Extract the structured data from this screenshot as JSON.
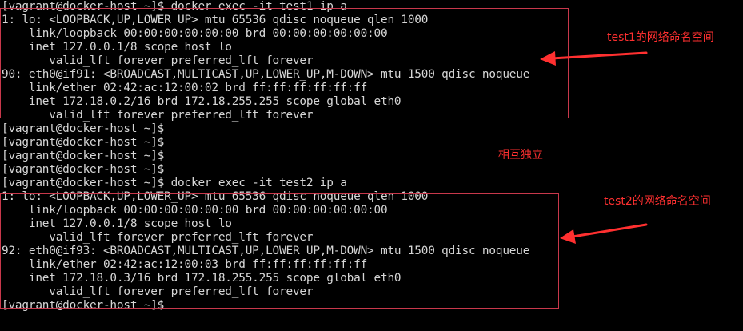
{
  "terminal": {
    "lines": [
      "[vagrant@docker-host ~]$ docker exec -it test1 ip a",
      "1: lo: <LOOPBACK,UP,LOWER_UP> mtu 65536 qdisc noqueue qlen 1000",
      "    link/loopback 00:00:00:00:00:00 brd 00:00:00:00:00:00",
      "    inet 127.0.0.1/8 scope host lo",
      "       valid_lft forever preferred_lft forever",
      "90: eth0@if91: <BROADCAST,MULTICAST,UP,LOWER_UP,M-DOWN> mtu 1500 qdisc noqueue",
      "    link/ether 02:42:ac:12:00:02 brd ff:ff:ff:ff:ff:ff",
      "    inet 172.18.0.2/16 brd 172.18.255.255 scope global eth0",
      "       valid_lft forever preferred_lft forever",
      "[vagrant@docker-host ~]$",
      "[vagrant@docker-host ~]$",
      "[vagrant@docker-host ~]$",
      "[vagrant@docker-host ~]$",
      "[vagrant@docker-host ~]$ docker exec -it test2 ip a",
      "1: lo: <LOOPBACK,UP,LOWER_UP> mtu 65536 qdisc noqueue qlen 1000",
      "    link/loopback 00:00:00:00:00:00 brd 00:00:00:00:00:00",
      "    inet 127.0.0.1/8 scope host lo",
      "       valid_lft forever preferred_lft forever",
      "92: eth0@if93: <BROADCAST,MULTICAST,UP,LOWER_UP,M-DOWN> mtu 1500 qdisc noqueue",
      "    link/ether 02:42:ac:12:00:03 brd ff:ff:ff:ff:ff:ff",
      "    inet 172.18.0.3/16 brd 172.18.255.255 scope global eth0",
      "       valid_lft forever preferred_lft forever",
      "[vagrant@docker-host ~]$"
    ]
  },
  "annotations": {
    "test1_label": "test1的网络命名空间",
    "middle_label": "相互独立",
    "test2_label": "test2的网络命名空间"
  },
  "colors": {
    "background": "#000000",
    "terminal_text": "#d6d6d6",
    "annotation": "#ff3030",
    "box_border": "#c8384b"
  }
}
